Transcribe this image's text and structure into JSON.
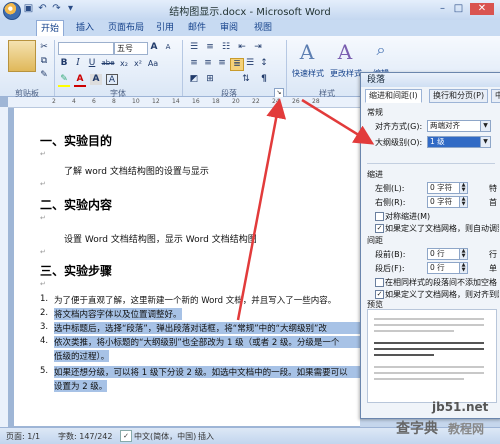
{
  "window": {
    "title": "结构图显示.docx - Microsoft Word"
  },
  "tabs": [
    "开始",
    "插入",
    "页面布局",
    "引用",
    "邮件",
    "审阅",
    "视图"
  ],
  "ribbon": {
    "font_size": "五号",
    "groups": [
      "剪贴板",
      "字体",
      "段落",
      "样式",
      "编辑"
    ],
    "styles_quick": "快速样式",
    "styles_change": "更改样式",
    "edit": "编辑",
    "font_buttons": [
      "B",
      "I",
      "U",
      "abe",
      "x₂",
      "x²",
      "Aa"
    ],
    "font_size_buttons": [
      "A",
      "A"
    ]
  },
  "ruler": [
    "2",
    "4",
    "6",
    "8",
    "10",
    "12",
    "14",
    "16",
    "18",
    "20",
    "22",
    "24",
    "26",
    "28"
  ],
  "document": {
    "h1": "一、实验目的",
    "p1": "了解 word 文档结构图的设置与显示",
    "h2": "二、实验内容",
    "p2": "设置 Word 文档结构图，显示 Word 文档结构图",
    "h3": "三、实验步骤",
    "steps": [
      {
        "num": "1.",
        "text": "为了便于直观了解，这里新建一个新的 Word 文档，并且写入了一些内容。",
        "hl": false
      },
      {
        "num": "2.",
        "text": "将文档内容字体以及位置调整好。",
        "hl": true
      },
      {
        "num": "3.",
        "text": "选中标题后，选择“段落”，弹出段落对话框，将“常规”中的“大纲级别”改",
        "hl": true
      },
      {
        "num": "4.",
        "text": "依次类推，将小标题的“大纲级别”也全部改为 1 级（或者 2 级。分级是一个",
        "hl": true
      },
      {
        "num": "",
        "text": "低级的过程）。",
        "hl": true
      },
      {
        "num": "5.",
        "text": "如果还想分级，可以将 1 级下分设 2 级。如选中文档中的一段。如果需要可以",
        "hl": true
      },
      {
        "num": "",
        "text": "设置为 2 级。",
        "hl": true
      }
    ]
  },
  "status": {
    "page": "页面: 1/1",
    "words": "字数: 147/242",
    "lang": "中文(简体，中国)",
    "mode": "插入"
  },
  "dialog": {
    "title": "段落",
    "tabs": [
      "缩进和间距(I)",
      "换行和分页(P)",
      "中"
    ],
    "general": "常规",
    "alignment_label": "对齐方式(G):",
    "alignment_value": "两端对齐",
    "outline_label": "大纲级别(O):",
    "outline_value": "1 级",
    "indent": "缩进",
    "left_label": "左侧(L):",
    "left_value": "0 字符",
    "right_label": "右侧(R):",
    "right_value": "0 字符",
    "special_1": "特",
    "special_2": "首",
    "symmetric": "对称缩进(M)",
    "grid_indent": "如果定义了文档网格，则自动调整",
    "spacing": "间距",
    "before_label": "段前(B):",
    "before_value": "0 行",
    "after_label": "段后(F):",
    "after_value": "0 行",
    "line_label_1": "行",
    "line_label_2": "单",
    "same_style": "在相同样式的段落间不添加空格",
    "grid_snap": "如果定义了文档网格，则对齐到网",
    "preview": "预览",
    "checks": {
      "symmetric": false,
      "grid_indent": true,
      "same_style": false,
      "grid_snap": true
    }
  },
  "watermark": {
    "site": "jb51.net",
    "brand": "查字典",
    "sub": "教程网"
  },
  "colors": {
    "arrow": "#e23b3b",
    "highlight": "#a7c2e6",
    "ribbon": "#dbe7f6"
  }
}
